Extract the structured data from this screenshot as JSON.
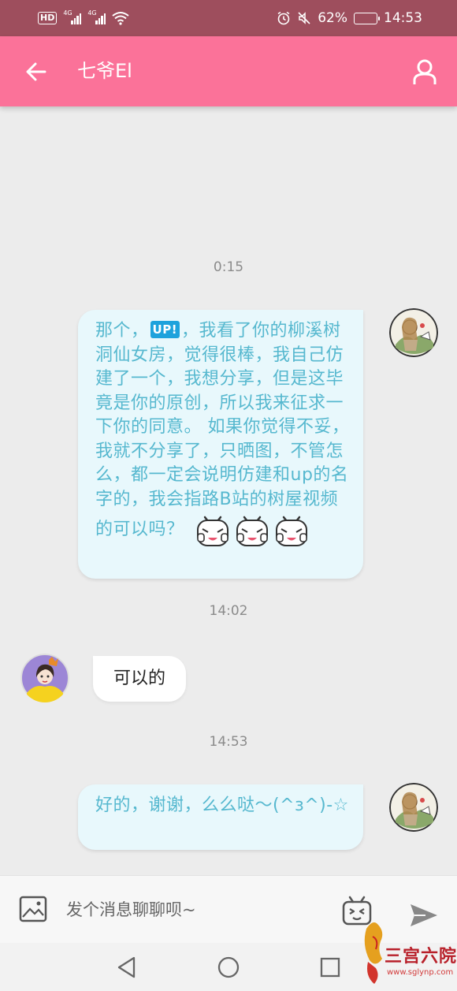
{
  "status_bar": {
    "hd_label": "HD",
    "network1": "4G",
    "network2": "4G",
    "battery_percent": "62%",
    "battery_level": 0.62,
    "clock": "14:53"
  },
  "header": {
    "title": "七爷El"
  },
  "messages": {
    "time1": "0:15",
    "msg1_before": "那个，",
    "msg1_badge": "UP!",
    "msg1_after": "，我看了你的柳溪树洞仙女房，觉得很棒，我自己仿建了一个，我想分享，但是这毕竟是你的原创，所以我来征求一下你的同意。 如果你觉得不妥，我就不分享了，只晒图，不管怎么，都一定会说明仿建和up的名字的，我会指路B站的树屋视频的可以吗？",
    "time2": "14:02",
    "msg2": "可以的",
    "time3": "14:53",
    "msg3": "好的，谢谢，么么哒～(^з^)-☆"
  },
  "input_bar": {
    "placeholder": "发个消息聊聊呗~"
  },
  "watermark": {
    "text": "三宫六院",
    "url": "www.sglynp.com"
  },
  "colors": {
    "status_bar": "#9e4e5d",
    "header": "#fb7299",
    "bubble_self_bg": "#e8f8fc",
    "bubble_self_text": "#56b8cf"
  }
}
